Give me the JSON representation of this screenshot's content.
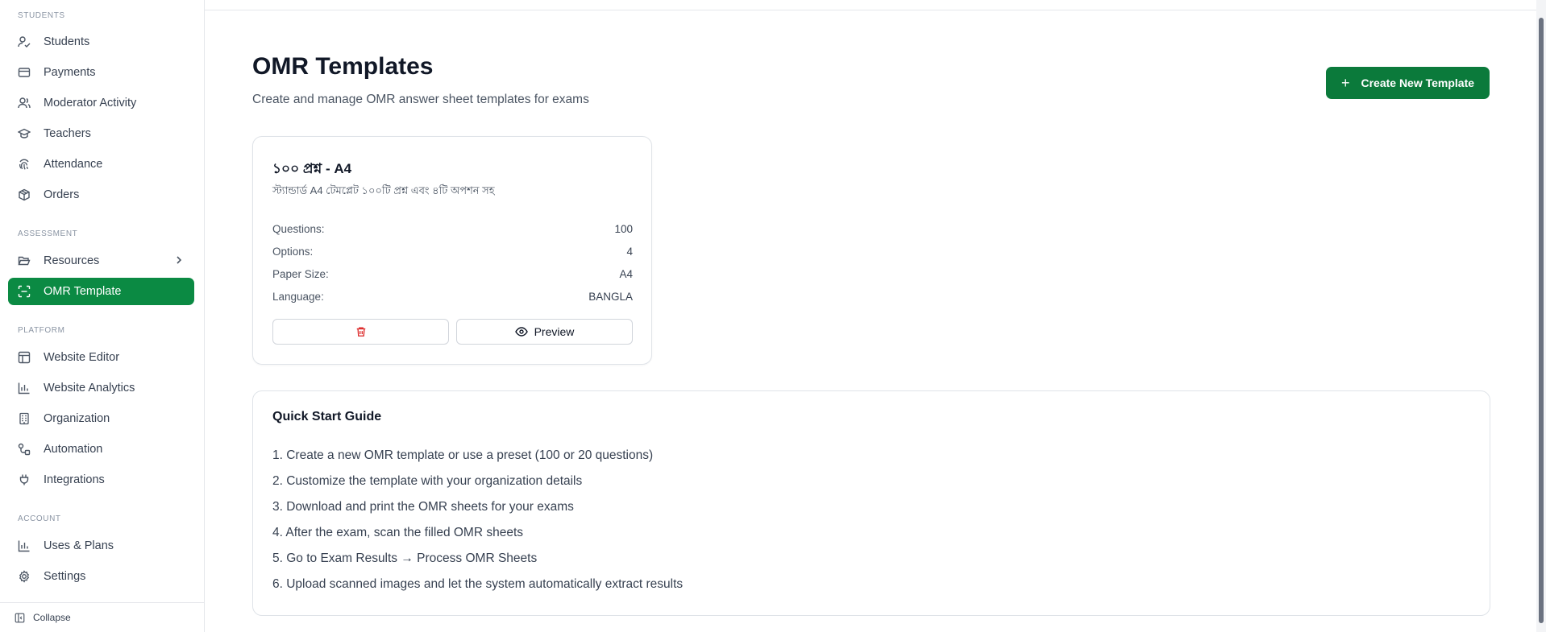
{
  "sidebar": {
    "sections": {
      "students": "STUDENTS",
      "assessment": "ASSESSMENT",
      "platform": "PLATFORM",
      "account": "ACCOUNT"
    },
    "items": {
      "students": "Students",
      "payments": "Payments",
      "moderator_activity": "Moderator Activity",
      "teachers": "Teachers",
      "attendance": "Attendance",
      "orders": "Orders",
      "resources": "Resources",
      "omr_template": "OMR Template",
      "website_editor": "Website Editor",
      "website_analytics": "Website Analytics",
      "organization": "Organization",
      "automation": "Automation",
      "integrations": "Integrations",
      "uses_plans": "Uses & Plans",
      "settings": "Settings"
    },
    "active_item": "OMR Template",
    "collapse_label": "Collapse"
  },
  "header": {
    "title": "OMR Templates",
    "subtitle": "Create and manage OMR answer sheet templates for exams",
    "create_button": "Create New Template"
  },
  "templates": [
    {
      "title": "১০০ প্রশ্ন - A4",
      "description": "স্ট্যান্ডার্ড A4 টেমপ্লেট ১০০টি প্রশ্ন এবং ৪টি অপশন সহ",
      "stats": {
        "questions_label": "Questions:",
        "questions_value": "100",
        "options_label": "Options:",
        "options_value": "4",
        "paper_size_label": "Paper Size:",
        "paper_size_value": "A4",
        "language_label": "Language:",
        "language_value": "BANGLA"
      },
      "preview_label": "Preview"
    }
  ],
  "quick_start": {
    "title": "Quick Start Guide",
    "steps": [
      "1. Create a new OMR template or use a preset (100 or 20 questions)",
      "2. Customize the template with your organization details",
      "3. Download and print the OMR sheets for your exams",
      "4. After the exam, scan the filled OMR sheets",
      "5. Go to Exam Results → Process OMR Sheets",
      "6. Upload scanned images and let the system automatically extract results"
    ]
  },
  "colors": {
    "accent": "#0b8a43",
    "button": "#0b7a3b",
    "danger": "#dc2626"
  }
}
